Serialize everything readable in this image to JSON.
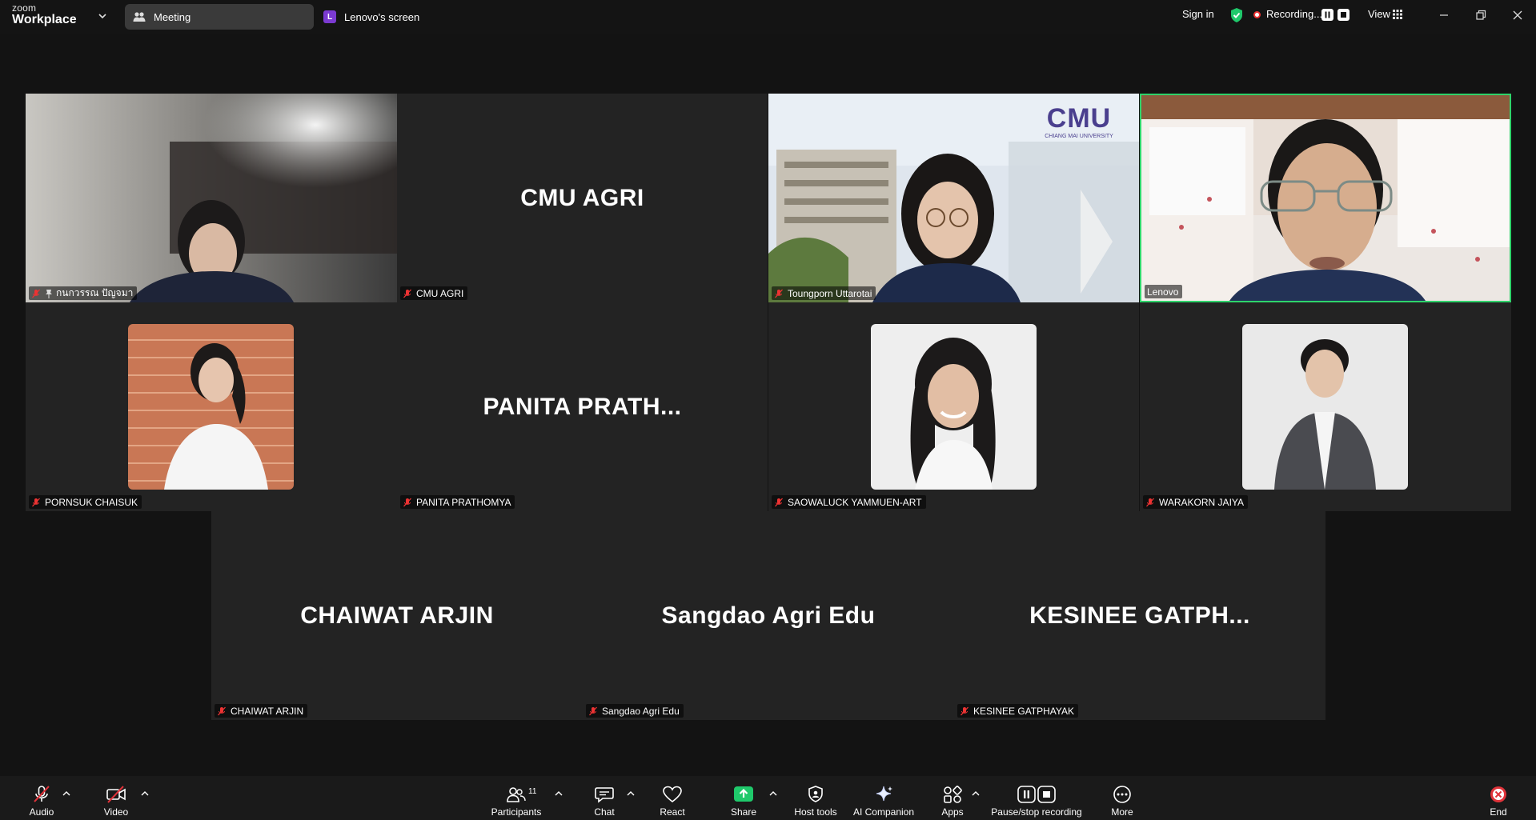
{
  "app": {
    "logo_top": "zoom",
    "logo_bottom": "Workplace"
  },
  "tabs": [
    {
      "label": "Meeting",
      "icon": "meeting-people-icon"
    },
    {
      "label": "Lenovo's screen",
      "badge": "L",
      "badge_color": "#7b3ad1"
    }
  ],
  "header": {
    "sign_in": "Sign in",
    "recording": "Recording...",
    "view": "View"
  },
  "colors": {
    "active_speaker": "#2fd36a",
    "tile_bg": "#232323",
    "share_green": "#1fc96b",
    "end_red": "#e0333a"
  },
  "participants": [
    {
      "name": "กนกวรรณ ปัญจมา",
      "type": "video",
      "muted": true,
      "pinned": true
    },
    {
      "name": "CMU AGRI",
      "type": "name",
      "display": "CMU AGRI",
      "muted": true
    },
    {
      "name": "Toungporn Uttarotai",
      "type": "video",
      "muted": true,
      "background_logo": "CMU",
      "background_logo_sub": "CHIANG MAI UNIVERSITY"
    },
    {
      "name": "Lenovo",
      "type": "video",
      "muted": false,
      "active_speaker": true
    },
    {
      "name": "PORNSUK CHAISUK",
      "type": "photo",
      "muted": true
    },
    {
      "name": "PANITA PRATHOMYA",
      "type": "name",
      "display": "PANITA  PRATH...",
      "muted": true
    },
    {
      "name": "SAOWALUCK YAMMUEN-ART",
      "type": "photo",
      "muted": true
    },
    {
      "name": "WARAKORN JAIYA",
      "type": "photo",
      "muted": true
    },
    {
      "name": "CHAIWAT ARJIN",
      "type": "name",
      "display": "CHAIWAT ARJIN",
      "muted": true
    },
    {
      "name": "Sangdao Agri Edu",
      "type": "name",
      "display": "Sangdao Agri Edu",
      "muted": true
    },
    {
      "name": "KESINEE GATPHAYAK",
      "type": "name",
      "display": "KESINEE  GATPH...",
      "muted": true
    }
  ],
  "toolbar": {
    "audio": "Audio",
    "video": "Video",
    "participants": "Participants",
    "participants_count": "11",
    "chat": "Chat",
    "react": "React",
    "share": "Share",
    "host_tools": "Host tools",
    "ai_companion": "AI Companion",
    "apps": "Apps",
    "pause_stop": "Pause/stop recording",
    "more": "More",
    "end": "End"
  }
}
